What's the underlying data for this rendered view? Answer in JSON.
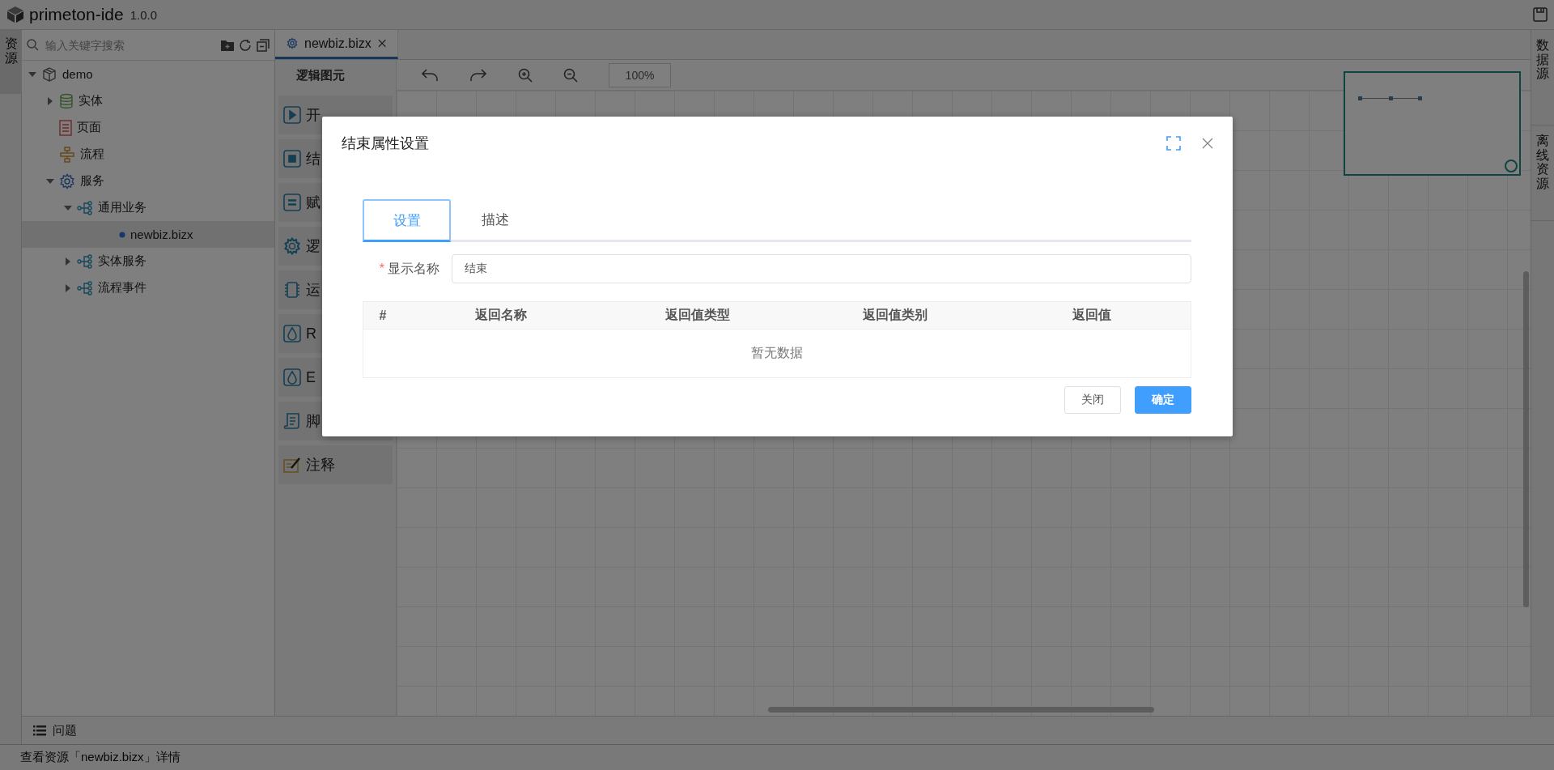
{
  "app": {
    "name": "primeton-ide",
    "version": "1.0.0"
  },
  "left_tabs": [
    {
      "label": "资源",
      "selected": true
    }
  ],
  "resource_panel": {
    "search": {
      "placeholder": "输入关键字搜索"
    },
    "tree": [
      {
        "label": "demo",
        "kind": "cube",
        "expanded": true,
        "selected": false,
        "children": [
          {
            "label": "实体",
            "kind": "database",
            "expanded": false,
            "selected": false
          },
          {
            "label": "页面",
            "kind": "page",
            "selected": false
          },
          {
            "label": "流程",
            "kind": "flow",
            "selected": false
          },
          {
            "label": "服务",
            "kind": "gear",
            "expanded": true,
            "selected": false,
            "children": [
              {
                "label": "通用业务",
                "kind": "branch",
                "expanded": true,
                "selected": false,
                "children": [
                  {
                    "label": "newbiz.bizx",
                    "kind": "dot",
                    "selected": true
                  }
                ]
              },
              {
                "label": "实体服务",
                "kind": "branch",
                "expanded": false,
                "selected": false
              },
              {
                "label": "流程事件",
                "kind": "branch",
                "expanded": false,
                "selected": false
              }
            ]
          }
        ]
      }
    ]
  },
  "editor_tabs": [
    {
      "label": "newbiz.bizx",
      "selected": true
    }
  ],
  "palette": {
    "title": "逻辑图元",
    "items": [
      {
        "kind": "start",
        "label": "开"
      },
      {
        "kind": "end",
        "label": "结"
      },
      {
        "kind": "assign",
        "label": "赋"
      },
      {
        "kind": "logic",
        "label": "逻"
      },
      {
        "kind": "chip",
        "label": "运"
      },
      {
        "kind": "rule",
        "label": "R"
      },
      {
        "kind": "expr",
        "label": "E"
      },
      {
        "kind": "script",
        "label": "脚"
      },
      {
        "kind": "note",
        "label": "注释"
      }
    ]
  },
  "toolbar": {
    "zoom": "100%"
  },
  "right_tabs": [
    {
      "label": "数据源",
      "selected": false
    },
    {
      "label": "离线资源",
      "selected": false
    }
  ],
  "bottom_panel": {
    "label": "问题"
  },
  "status_bar": "查看资源「newbiz.bizx」详情",
  "dialog": {
    "title": "结束属性设置",
    "tabs": [
      {
        "label": "设置",
        "selected": true
      },
      {
        "label": "描述",
        "selected": false
      }
    ],
    "field": {
      "required_mark": "*",
      "label": "显示名称",
      "value": "结束"
    },
    "table": {
      "columns": [
        "#",
        "返回名称",
        "返回值类型",
        "返回值类别",
        "返回值"
      ],
      "empty_text": "暂无数据"
    },
    "buttons": [
      {
        "label": "关闭",
        "kind": "default"
      },
      {
        "label": "确定",
        "kind": "primary"
      }
    ]
  }
}
